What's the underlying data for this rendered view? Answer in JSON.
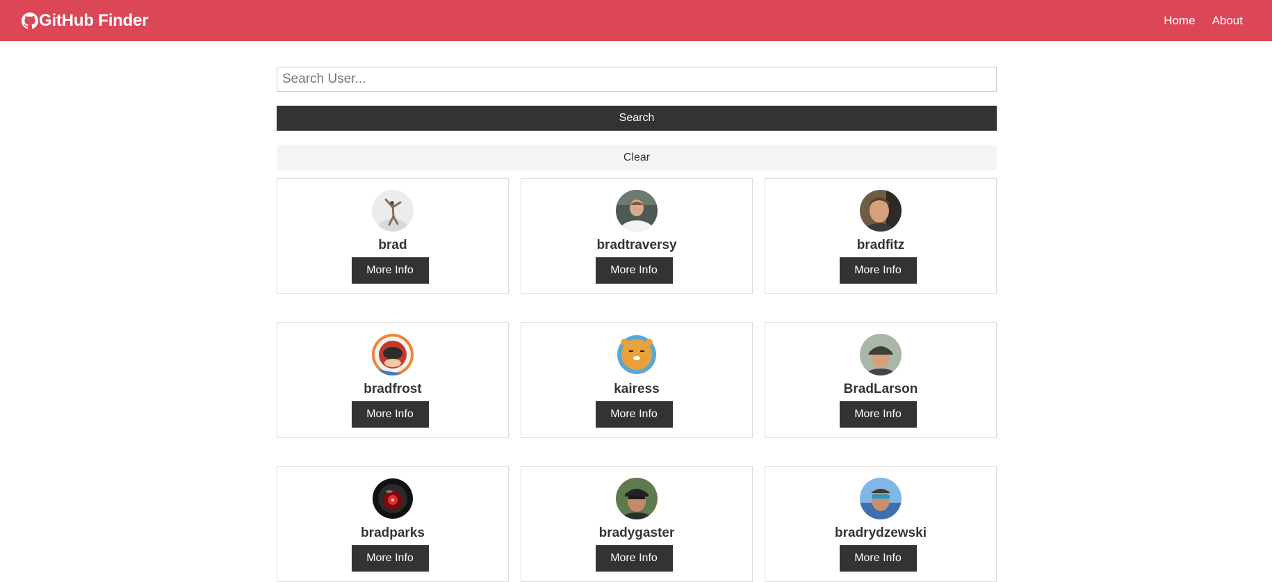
{
  "navbar": {
    "brand": "GitHub Finder",
    "brand_icon": "github-icon",
    "links": [
      "Home",
      "About"
    ],
    "background": "#dc4757"
  },
  "search": {
    "placeholder": "Search User...",
    "value": "",
    "search_label": "Search",
    "clear_label": "Clear"
  },
  "users": [
    {
      "login": "brad",
      "button": "More Info"
    },
    {
      "login": "bradtraversy",
      "button": "More Info"
    },
    {
      "login": "bradfitz",
      "button": "More Info"
    },
    {
      "login": "bradfrost",
      "button": "More Info"
    },
    {
      "login": "kairess",
      "button": "More Info"
    },
    {
      "login": "BradLarson",
      "button": "More Info"
    },
    {
      "login": "bradparks",
      "button": "More Info"
    },
    {
      "login": "bradygaster",
      "button": "More Info"
    },
    {
      "login": "bradrydzewski",
      "button": "More Info"
    }
  ]
}
